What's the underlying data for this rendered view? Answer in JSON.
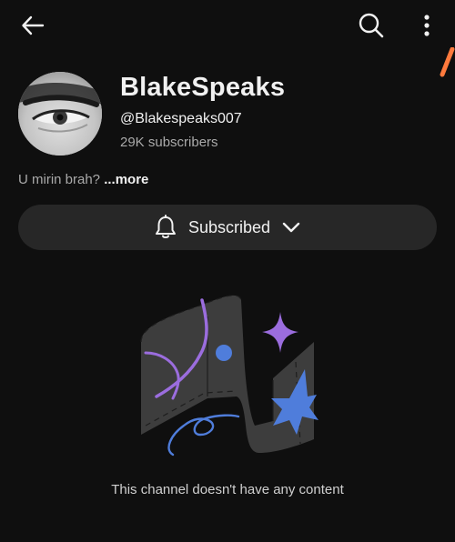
{
  "header": {
    "back_icon": "back-arrow-icon",
    "search_icon": "search-icon",
    "more_icon": "more-vertical-icon"
  },
  "channel": {
    "name": "BlakeSpeaks",
    "handle": "@Blakespeaks007",
    "subscribers": "29K subscribers",
    "description": "U mirin brah?",
    "more_label": "...more"
  },
  "subscribe_button": {
    "label": "Subscribed",
    "bell_icon": "bell-icon",
    "chevron_icon": "chevron-down-icon"
  },
  "empty_state": {
    "message": "This channel doesn't have any content"
  },
  "colors": {
    "background": "#0f0f0f",
    "button_bg": "#272727",
    "accent_orange": "#ff7a3d",
    "illustration_purple": "#9b6dde",
    "illustration_blue": "#4f7ddb"
  }
}
